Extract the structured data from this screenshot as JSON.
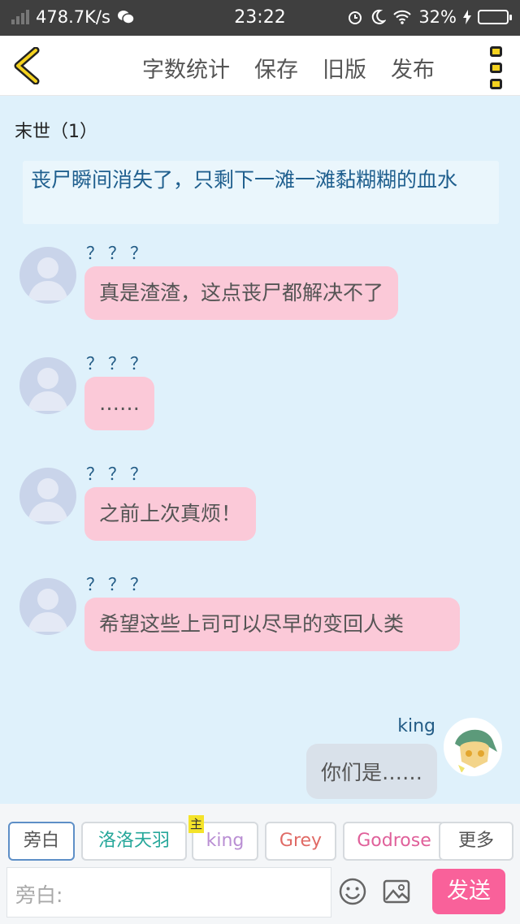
{
  "status_bar": {
    "network_speed": "478.7K/s",
    "time": "23:22",
    "battery": "32%",
    "battery_level": 0.32
  },
  "nav": {
    "actions": [
      "字数统计",
      "保存",
      "旧版",
      "发布"
    ]
  },
  "chat": {
    "chapter": "末世（1）",
    "narration": "丧尸瞬间消失了，只剩下一滩一滩黏糊糊的血水",
    "messages": [
      {
        "name": "？？？",
        "text": "真是渣渣，这点丧尸都解决不了"
      },
      {
        "name": "？？？",
        "text": "……"
      },
      {
        "name": "？？？",
        "text": "之前上次真烦！"
      },
      {
        "name": "？？？",
        "text": "希望这些上司可以尽早的变回人类"
      }
    ],
    "self_message": {
      "name": "king",
      "text": "你们是……"
    }
  },
  "roles": {
    "items": [
      "旁白",
      "洛洛天羽",
      "king",
      "Grey",
      "Godrose",
      "更多"
    ],
    "host_badge": "主",
    "active": "旁白"
  },
  "composer": {
    "placeholder": "旁白:",
    "send_label": "发送"
  },
  "colors": {
    "bubble": "#fbc9d8",
    "send": "#f9619a",
    "chat_bg": "#dff1fb"
  }
}
